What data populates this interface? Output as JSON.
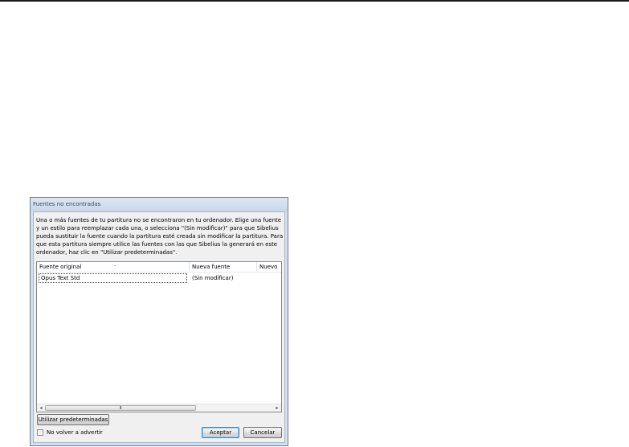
{
  "dialog": {
    "title": "Fuentes no encontradas",
    "message": "Una o más fuentes de tu partitura no se encontraron en tu ordenador. Elige una fuente y un estilo para reemplazar cada una, o selecciona \"(Sin modificar)\" para que Sibelius pueda sustituir la fuente cuando la partitura esté creada sin modificar la partitura. Para que esta partitura siempre utilice las fuentes con las que Sibelius la generará en este ordenador, haz clic en \"Utilizar predeterminadas\".",
    "columns": [
      "Fuente original",
      "Nueva fuente",
      "Nuevo"
    ],
    "rows": [
      {
        "original": "Opus Text Std",
        "new_font": "(Sin modificar)"
      }
    ],
    "scroll_grip": "III",
    "use_defaults_button": "Utilizar predeterminadas",
    "dont_warn_label": "No volver a advertir",
    "dont_warn_checked": false,
    "ok_button": "Aceptar",
    "cancel_button": "Cancelar"
  }
}
